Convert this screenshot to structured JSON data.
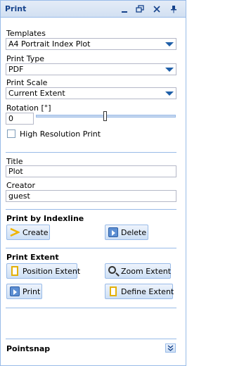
{
  "window": {
    "title": "Print",
    "tools": [
      "minimize-icon",
      "restore-icon",
      "close-icon",
      "pin-icon"
    ]
  },
  "templates": {
    "label": "Templates",
    "value": "A4 Portrait Index Plot"
  },
  "print_type": {
    "label": "Print Type",
    "value": "PDF"
  },
  "print_scale": {
    "label": "Print Scale",
    "value": "Current Extent"
  },
  "rotation": {
    "label": "Rotation [°]",
    "value": "0"
  },
  "high_res": {
    "label": "High Resolution Print",
    "checked": false
  },
  "title_field": {
    "label": "Title",
    "value": "Plot"
  },
  "creator_field": {
    "label": "Creator",
    "value": "guest"
  },
  "indexline": {
    "heading": "Print by Indexline",
    "create_label": "Create",
    "delete_label": "Delete"
  },
  "extent": {
    "heading": "Print Extent",
    "position_label": "Position Extent",
    "zoom_label": "Zoom Extent",
    "print_label": "Print",
    "define_label": "Define Extent"
  },
  "pointsnap": {
    "heading": "Pointsnap"
  },
  "colors": {
    "accent": "#99bbe8",
    "title_text": "#15428b",
    "arrow": "#1f5fa8"
  }
}
